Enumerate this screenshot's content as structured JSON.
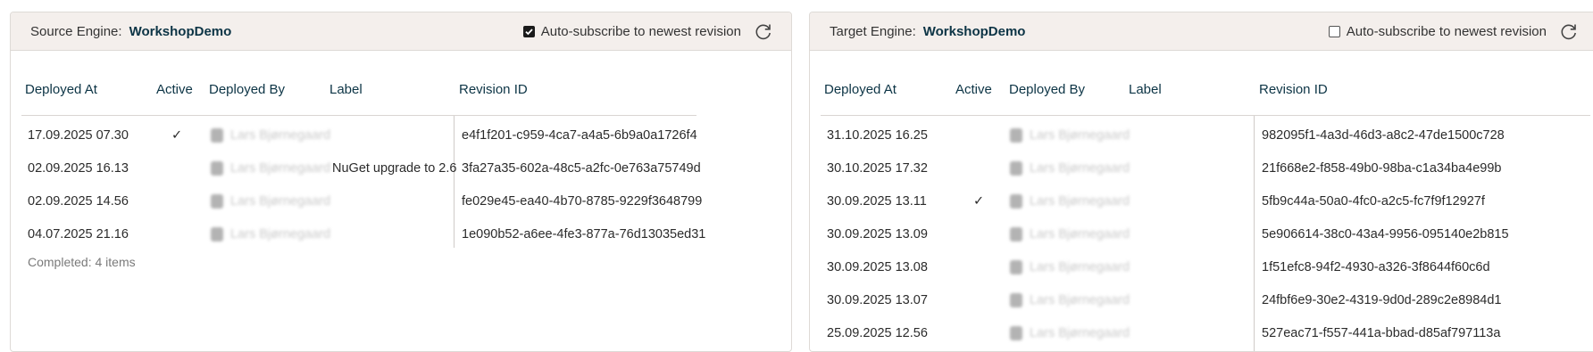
{
  "source": {
    "label": "Source Engine:",
    "engine": "WorkshopDemo",
    "auto_subscribe_label": "Auto-subscribe to newest revision",
    "auto_subscribe_checked": true,
    "columns": [
      "Deployed At",
      "Active",
      "Deployed By",
      "Label",
      "Revision ID"
    ],
    "rows": [
      {
        "deployed_at": "17.09.2025 07.30",
        "active": "✓",
        "deployed_by": "Lars Bjørnegaard",
        "label": "",
        "revision_id": "e4f1f201-c959-4ca7-a4a5-6b9a0a1726f4"
      },
      {
        "deployed_at": "02.09.2025 16.13",
        "active": "",
        "deployed_by": "Lars Bjørnegaard",
        "label": "NuGet upgrade to 2.6",
        "revision_id": "3fa27a35-602a-48c5-a2fc-0e763a75749d"
      },
      {
        "deployed_at": "02.09.2025 14.56",
        "active": "",
        "deployed_by": "Lars Bjørnegaard",
        "label": "",
        "revision_id": "fe029e45-ea40-4b70-8785-9229f3648799"
      },
      {
        "deployed_at": "04.07.2025 21.16",
        "active": "",
        "deployed_by": "Lars Bjørnegaard",
        "label": "",
        "revision_id": "1e090b52-a6ee-4fe3-877a-76d13035ed31"
      }
    ],
    "status": "Completed: 4 items"
  },
  "target": {
    "label": "Target Engine:",
    "engine": "WorkshopDemo",
    "auto_subscribe_label": "Auto-subscribe to newest revision",
    "auto_subscribe_checked": false,
    "columns": [
      "Deployed At",
      "Active",
      "Deployed By",
      "Label",
      "Revision ID"
    ],
    "rows": [
      {
        "deployed_at": "31.10.2025 16.25",
        "active": "",
        "deployed_by": "Lars Bjørnegaard",
        "label": "",
        "revision_id": "982095f1-4a3d-46d3-a8c2-47de1500c728"
      },
      {
        "deployed_at": "30.10.2025 17.32",
        "active": "",
        "deployed_by": "Lars Bjørnegaard",
        "label": "",
        "revision_id": "21f668e2-f858-49b0-98ba-c1a34ba4e99b"
      },
      {
        "deployed_at": "30.09.2025 13.11",
        "active": "✓",
        "deployed_by": "Lars Bjørnegaard",
        "label": "",
        "revision_id": "5fb9c44a-50a0-4fc0-a2c5-fc7f9f12927f"
      },
      {
        "deployed_at": "30.09.2025 13.09",
        "active": "",
        "deployed_by": "Lars Bjørnegaard",
        "label": "",
        "revision_id": "5e906614-38c0-43a4-9956-095140e2b815"
      },
      {
        "deployed_at": "30.09.2025 13.08",
        "active": "",
        "deployed_by": "Lars Bjørnegaard",
        "label": "",
        "revision_id": "1f51efc8-94f2-4930-a326-3f8644f60c6d"
      },
      {
        "deployed_at": "30.09.2025 13.07",
        "active": "",
        "deployed_by": "Lars Bjørnegaard",
        "label": "",
        "revision_id": "24fbf6e9-30e2-4319-9d0d-289c2e8984d1"
      },
      {
        "deployed_at": "25.09.2025 12.56",
        "active": "",
        "deployed_by": "Lars Bjørnegaard",
        "label": "",
        "revision_id": "527eac71-f557-441a-bbad-d85af797113a"
      }
    ]
  },
  "icons": {
    "refresh": "refresh-icon",
    "checkmark": "checkmark-icon",
    "user": "user-avatar-icon"
  },
  "colors": {
    "header_bg": "#f4efec",
    "accent": "#0c3445",
    "border": "#dedad6"
  }
}
